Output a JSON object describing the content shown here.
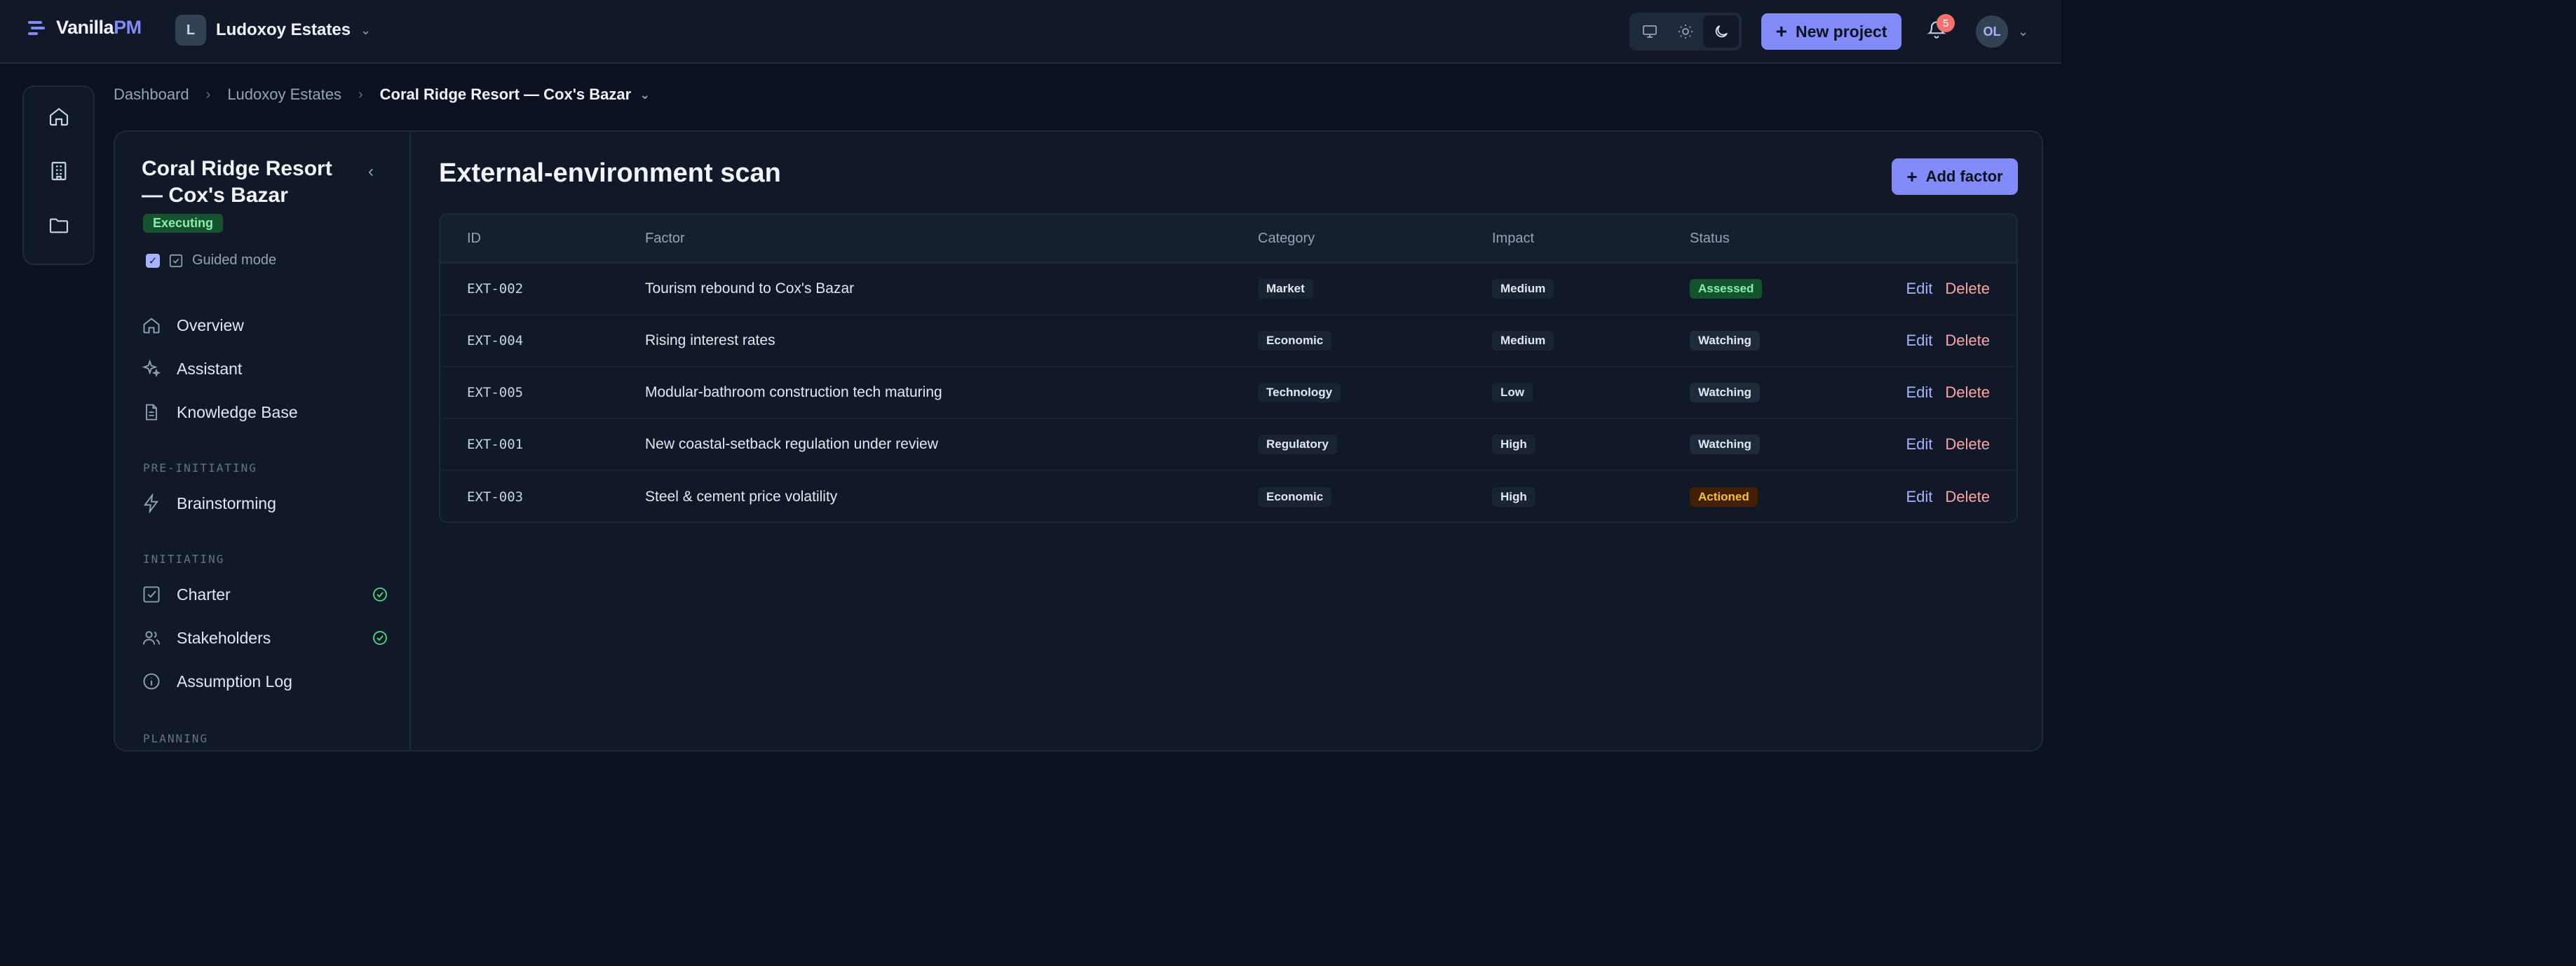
{
  "header": {
    "logo_main": "Vanilla",
    "logo_accent": "PM",
    "workspace_initial": "L",
    "workspace_name": "Ludoxoy Estates",
    "new_project_label": "New project",
    "notification_count": "5",
    "user_initials": "OL",
    "accent_color": "#818cf8"
  },
  "breadcrumb": {
    "items": [
      "Dashboard",
      "Ludoxoy Estates"
    ],
    "current": "Coral Ridge Resort — Cox's Bazar"
  },
  "sidebar": {
    "project_title": "Coral Ridge Resort — Cox's Bazar",
    "status": "Executing",
    "guided_mode_label": "Guided mode",
    "guided_mode_checked": true,
    "items": [
      {
        "label": "Overview",
        "icon": "home-icon"
      },
      {
        "label": "Assistant",
        "icon": "sparkles-icon"
      },
      {
        "label": "Knowledge Base",
        "icon": "document-icon"
      }
    ],
    "sections": [
      {
        "title": "PRE-INITIATING",
        "items": [
          {
            "label": "Brainstorming",
            "icon": "bolt-icon"
          }
        ]
      },
      {
        "title": "INITIATING",
        "items": [
          {
            "label": "Charter",
            "icon": "checkbox-icon",
            "done": true
          },
          {
            "label": "Stakeholders",
            "icon": "users-icon",
            "done": true
          },
          {
            "label": "Assumption Log",
            "icon": "info-icon"
          }
        ]
      },
      {
        "title": "PLANNING",
        "items": []
      }
    ]
  },
  "main": {
    "title": "External-environment scan",
    "add_label": "Add factor",
    "columns": [
      "ID",
      "Factor",
      "Category",
      "Impact",
      "Status"
    ],
    "edit_label": "Edit",
    "delete_label": "Delete",
    "rows": [
      {
        "id": "EXT-002",
        "factor": "Tourism rebound to Cox's Bazar",
        "category": "Market",
        "impact": "Medium",
        "status": "Assessed"
      },
      {
        "id": "EXT-004",
        "factor": "Rising interest rates",
        "category": "Economic",
        "impact": "Medium",
        "status": "Watching"
      },
      {
        "id": "EXT-005",
        "factor": "Modular-bathroom construction tech maturing",
        "category": "Technology",
        "impact": "Low",
        "status": "Watching"
      },
      {
        "id": "EXT-001",
        "factor": "New coastal-setback regulation under review",
        "category": "Regulatory",
        "impact": "High",
        "status": "Watching"
      },
      {
        "id": "EXT-003",
        "factor": "Steel & cement price volatility",
        "category": "Economic",
        "impact": "High",
        "status": "Actioned"
      }
    ]
  }
}
